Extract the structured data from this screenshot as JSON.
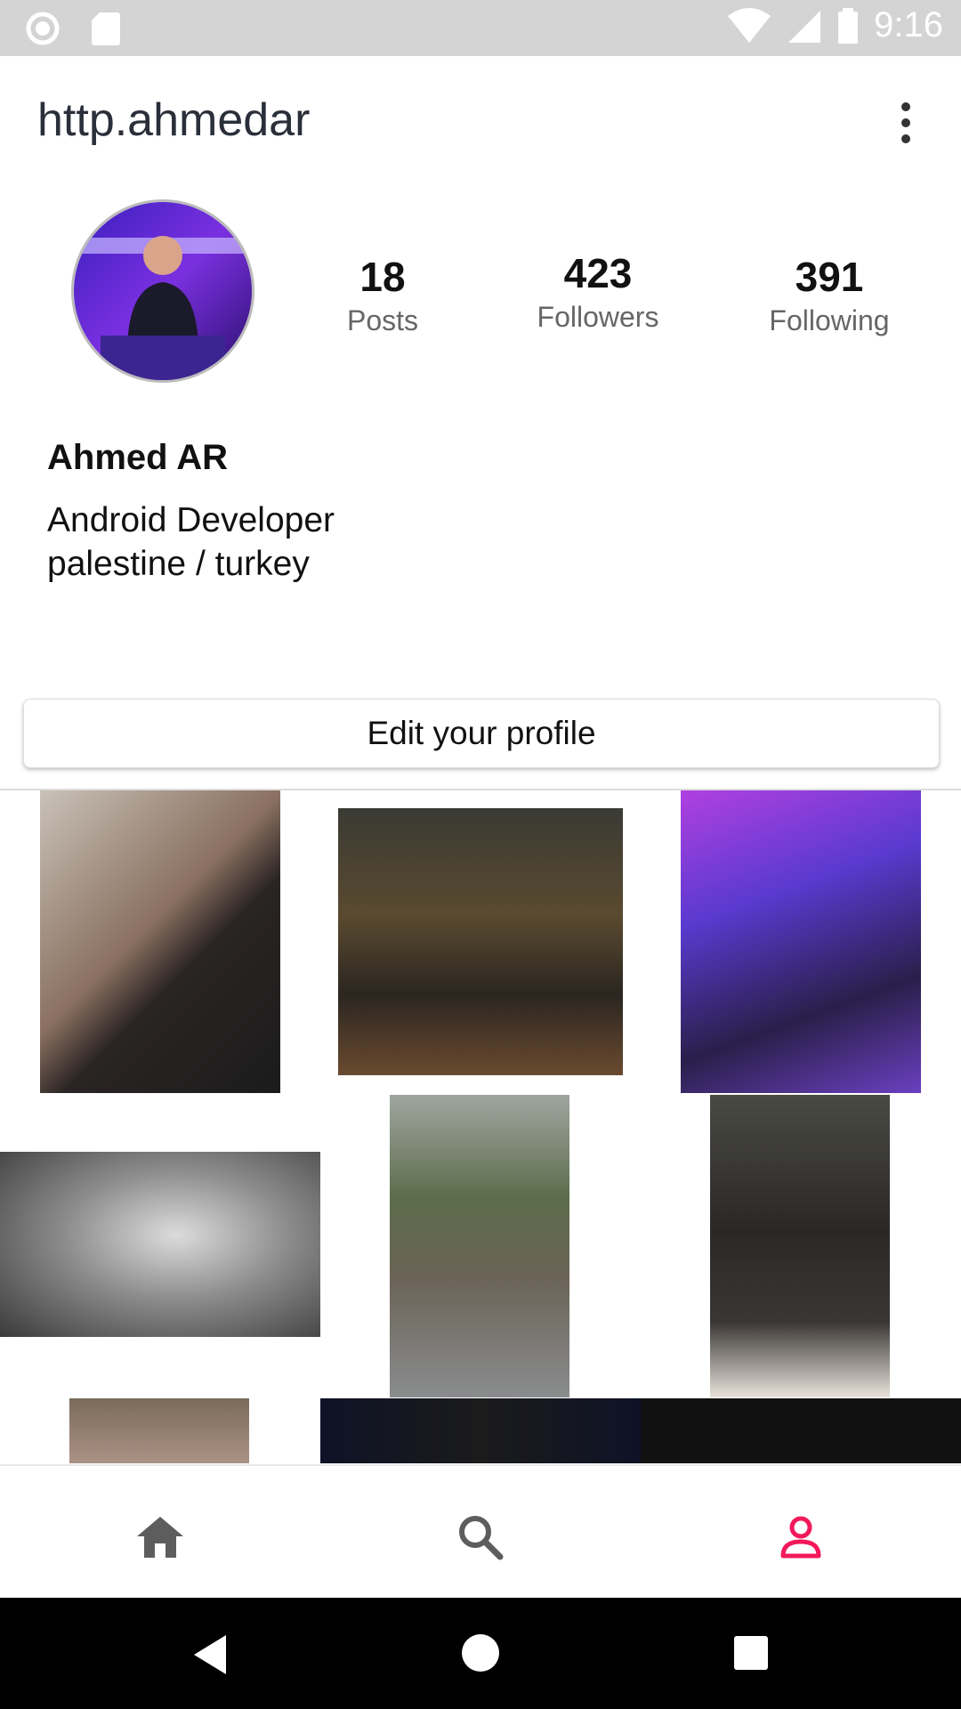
{
  "status_bar": {
    "time": "9:16",
    "icons": [
      "record-icon",
      "sd-card-icon",
      "wifi-icon",
      "signal-icon",
      "battery-icon"
    ]
  },
  "header": {
    "username": "http.ahmedar",
    "menu_icon": "more-vert-icon"
  },
  "profile": {
    "stats": [
      {
        "value": "18",
        "label": "Posts"
      },
      {
        "value": "423",
        "label": "Followers"
      },
      {
        "value": "391",
        "label": "Following"
      }
    ],
    "name": "Ahmed AR",
    "bio_line1": "Android Developer",
    "bio_line2": "palestine / turkey",
    "edit_button": "Edit your profile"
  },
  "bottom_nav": {
    "items": [
      {
        "icon": "home-icon",
        "active": false
      },
      {
        "icon": "search-icon",
        "active": false
      },
      {
        "icon": "profile-icon",
        "active": true
      }
    ],
    "active_color": "#f2195b",
    "inactive_color": "#5d5d5d"
  },
  "system_nav": [
    "back-icon",
    "home-circle-icon",
    "recents-icon"
  ]
}
